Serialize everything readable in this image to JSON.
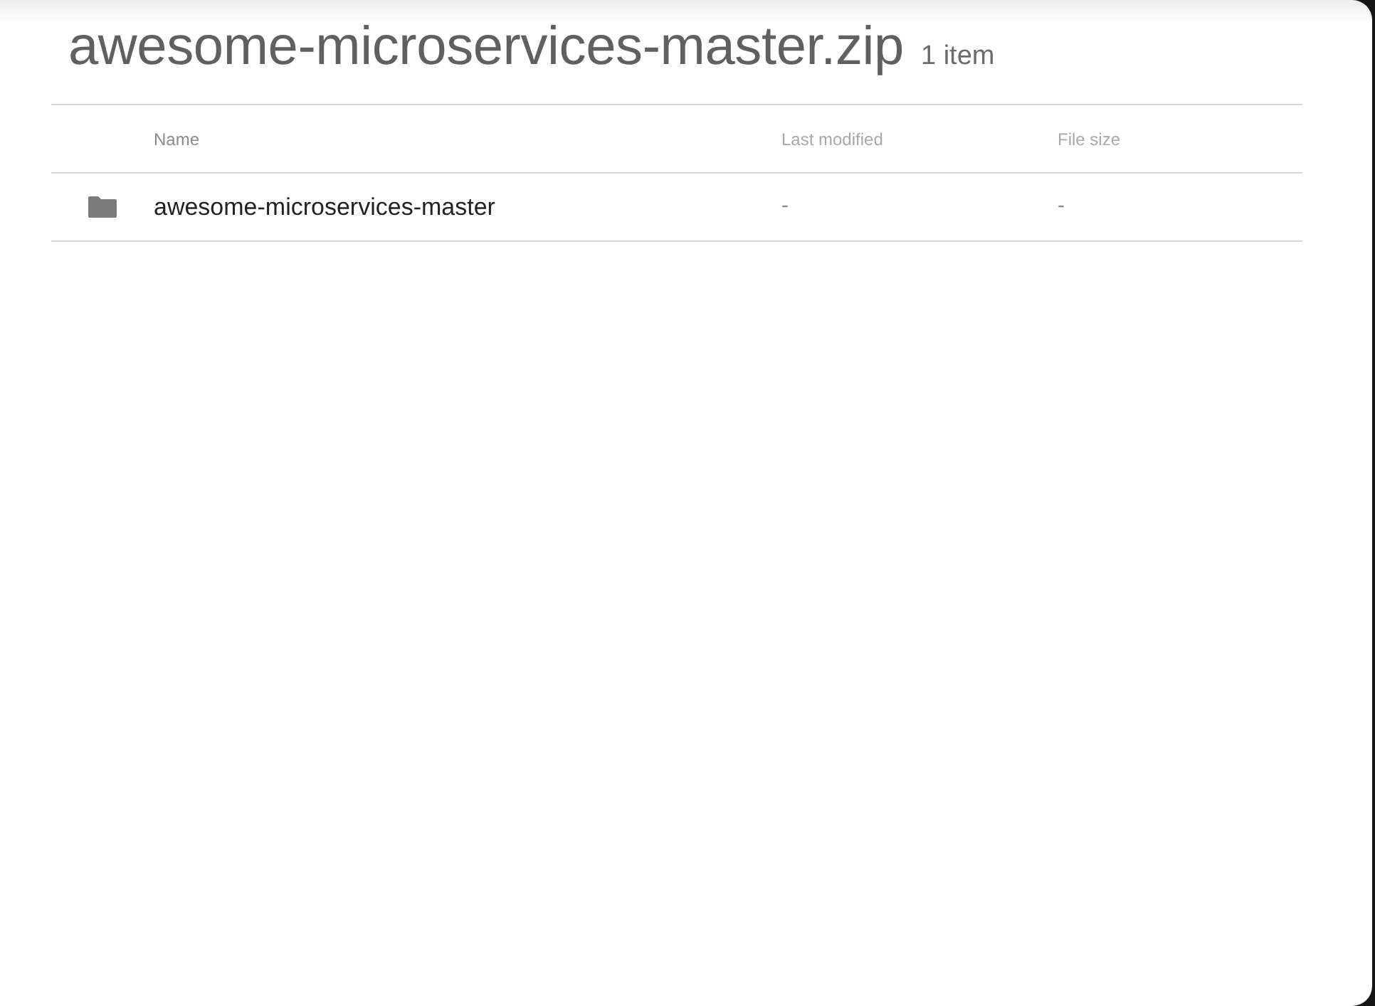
{
  "title": "awesome-microservices-master.zip",
  "item_count": "1 item",
  "table": {
    "columns": [
      "Name",
      "Last modified",
      "File size"
    ],
    "rows": [
      {
        "kind": "folder",
        "name": "awesome-microservices-master",
        "last_modified": "-",
        "file_size": "-"
      }
    ]
  }
}
